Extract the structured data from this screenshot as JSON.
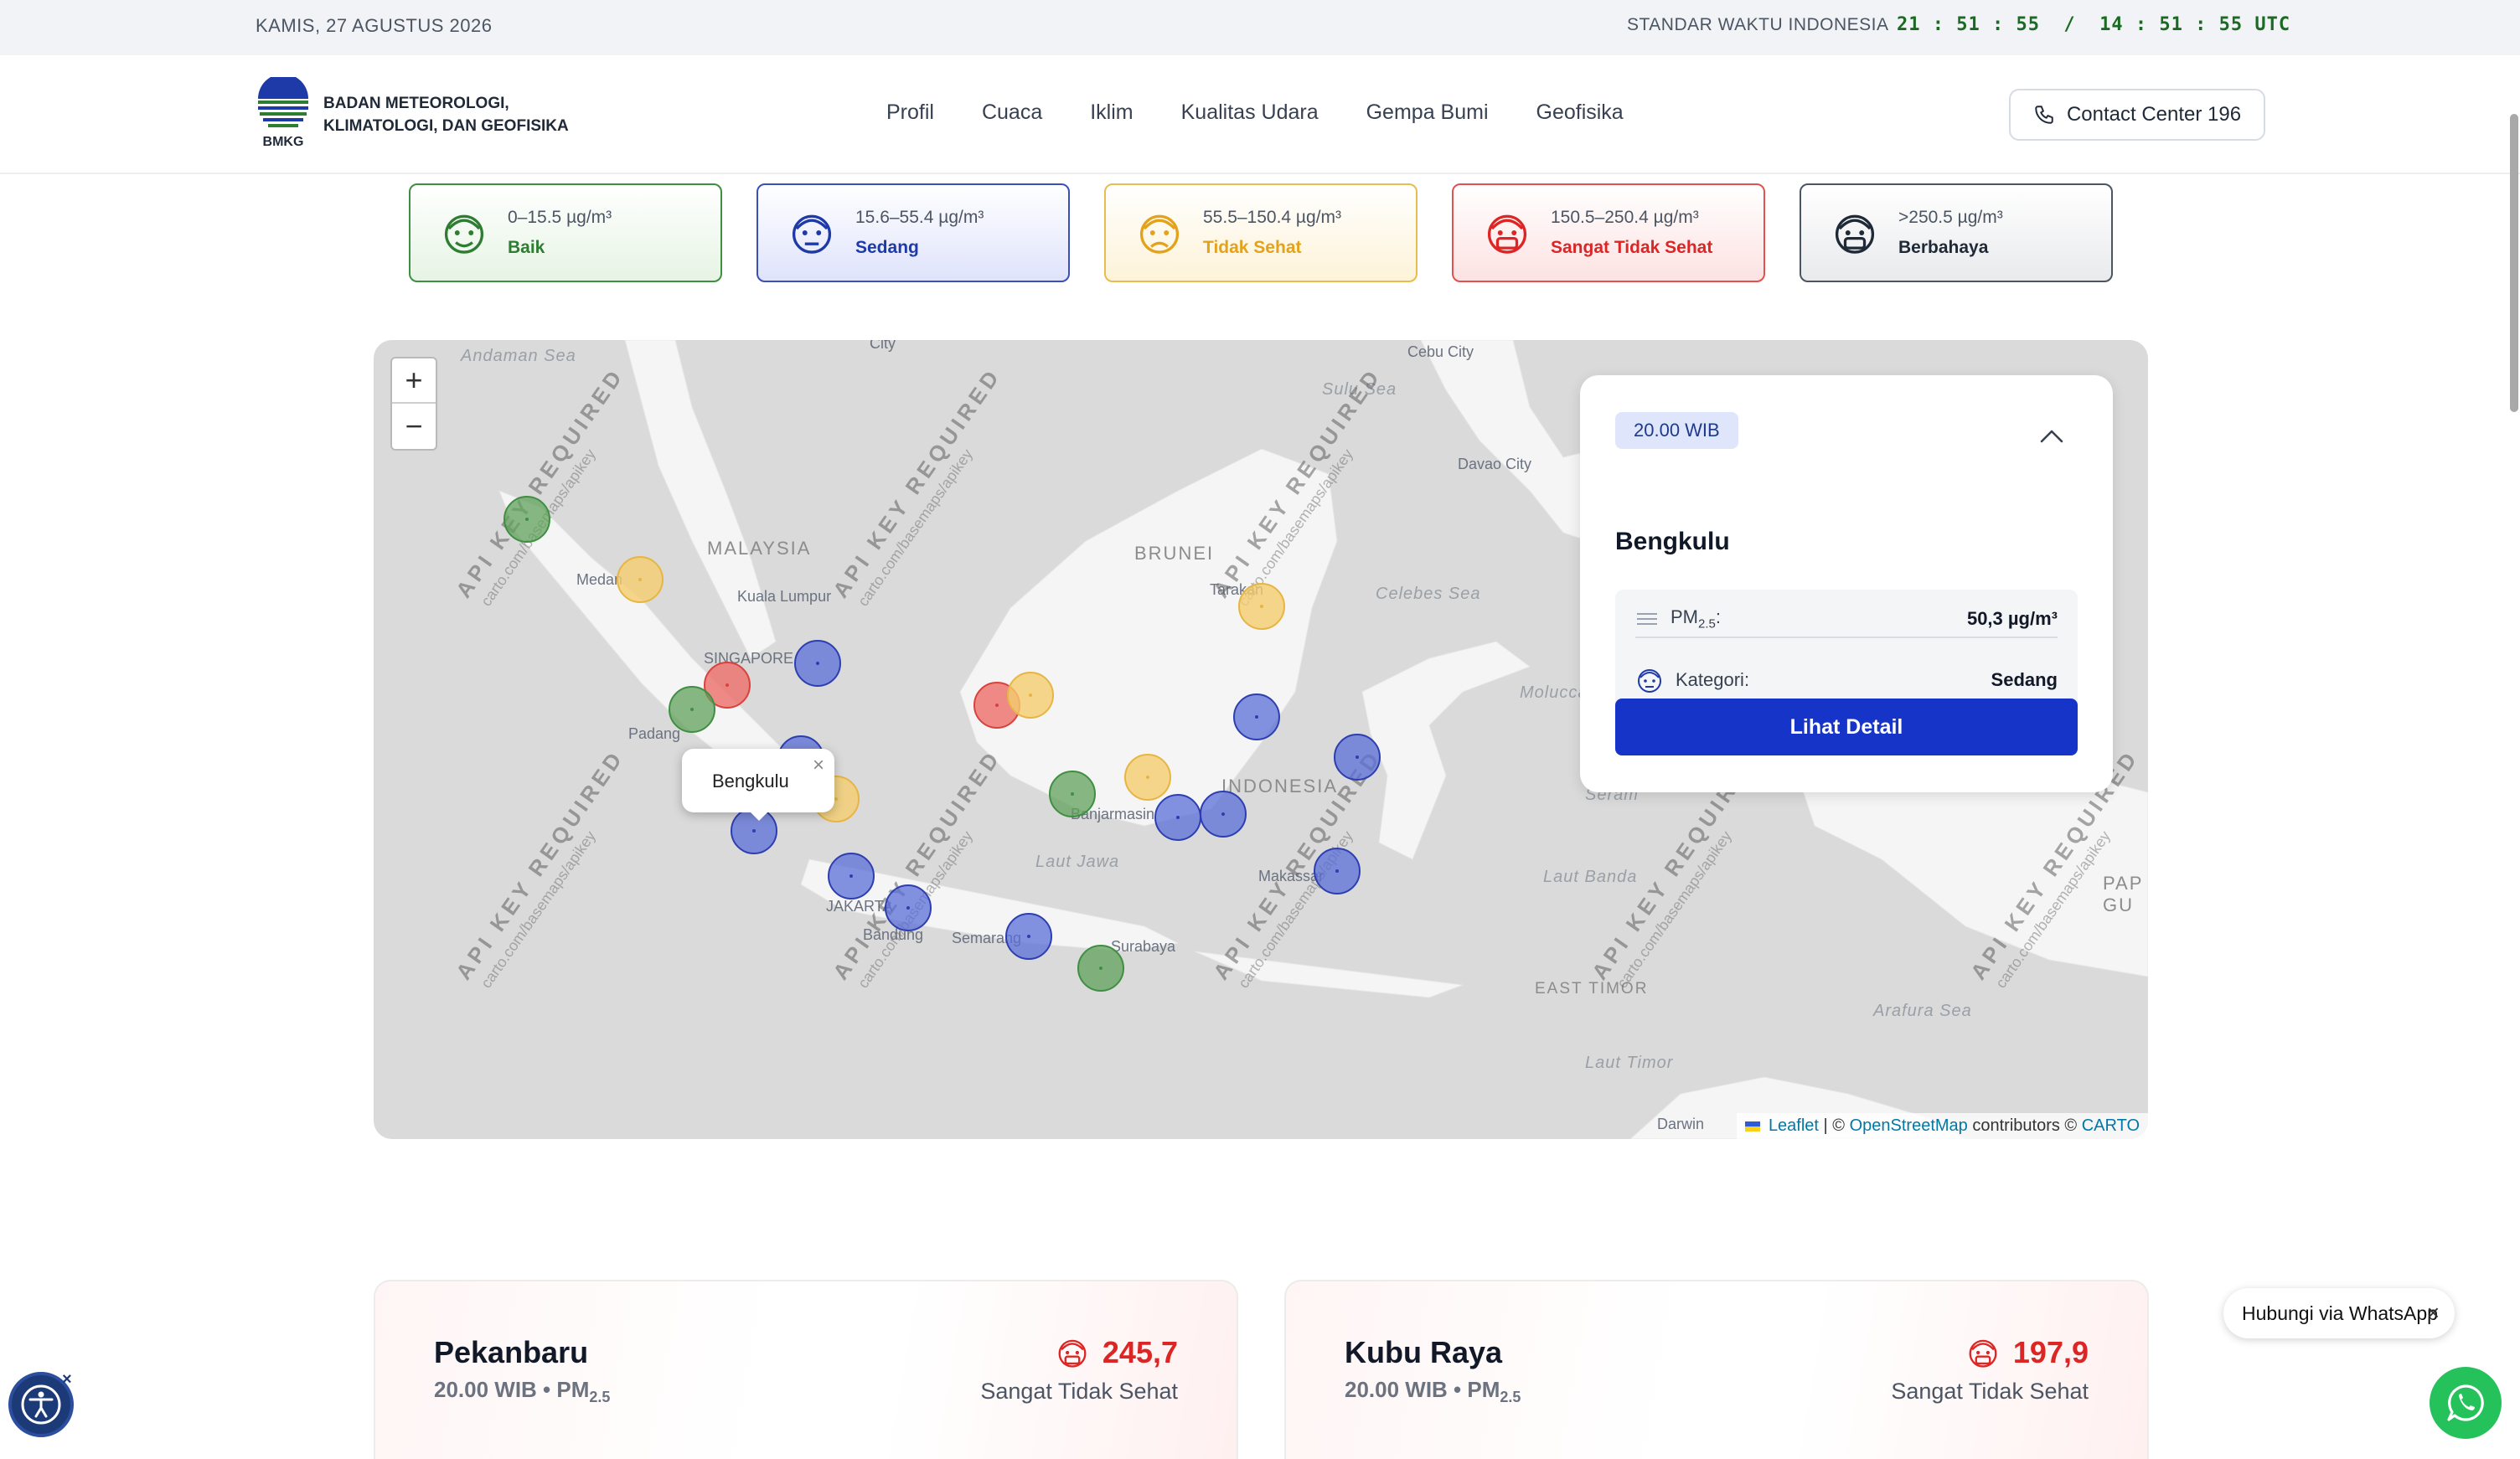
{
  "topbar": {
    "date": "KAMIS, 27 AGUSTUS 2026",
    "standard_label": "STANDAR WAKTU INDONESIA",
    "clock": "21 : 51 : 55  /  14 : 51 : 55 UTC"
  },
  "header": {
    "org_name_line1": "BADAN METEOROLOGI,",
    "org_name_line2": "KLIMATOLOGI, DAN GEOFISIKA",
    "logo_text": "BMKG",
    "nav": [
      "Profil",
      "Cuaca",
      "Iklim",
      "Kualitas Udara",
      "Gempa Bumi",
      "Geofisika"
    ],
    "contact_label": "Contact Center 196"
  },
  "legend": [
    {
      "range": "0–15.5 µg/m³",
      "category": "Baik",
      "color": "#2f7d32",
      "bg": "#e6f4e4",
      "border": "#3f8f43"
    },
    {
      "range": "15.6–55.4 µg/m³",
      "category": "Sedang",
      "color": "#1e3aa8",
      "bg": "#dfe3fb",
      "border": "#3b4fb8"
    },
    {
      "range": "55.5–150.4 µg/m³",
      "category": "Tidak Sehat",
      "color": "#e4a21b",
      "bg": "#fdf3d9",
      "border": "#e7bd4f"
    },
    {
      "range": "150.5–250.4 µg/m³",
      "category": "Sangat Tidak Sehat",
      "color": "#dc2626",
      "bg": "#fde2e2",
      "border": "#e0514f"
    },
    {
      "range": ">250.5 µg/m³",
      "category": "Berbahaya",
      "color": "#1f2937",
      "bg": "#e9eaec",
      "border": "#4b5563"
    }
  ],
  "map": {
    "seas": [
      "Andaman Sea",
      "Sulu Sea",
      "Celebes Sea",
      "Molucca Sea",
      "Laut Jawa",
      "Laut Banda",
      "Arafura Sea",
      "Laut Timor",
      "Seram"
    ],
    "countries": [
      "MALAYSIA",
      "BRUNEI",
      "INDONESIA",
      "EAST TIMOR",
      "PAP GU"
    ],
    "cities": [
      "City",
      "Cebu City",
      "Davao City",
      "Medan",
      "Kuala Lumpur",
      "SINGAPORE",
      "Padang",
      "Tarakan",
      "Banjarmasin",
      "Makassar",
      "JAKARTA",
      "Bandung",
      "Semarang",
      "Surabaya",
      "Darwin"
    ],
    "watermark": "API KEY REQUIRED",
    "watermark_url": "carto.com/basemaps/apikey",
    "zoom_in": "+",
    "zoom_out": "−",
    "attribution_leaflet": "Leaflet",
    "attribution_sep": " | © ",
    "attribution_osm": "OpenStreetMap",
    "attribution_contrib": " contributors © ",
    "attribution_carto": "CARTO",
    "popup_label": "Bengkulu",
    "popup_close": "×",
    "stations": [
      {
        "level": "Baik"
      },
      {
        "level": "Tidak Sehat"
      },
      {
        "level": "Sangat Tidak Sehat"
      },
      {
        "level": "Sedang"
      },
      {
        "level": "Baik"
      },
      {
        "level": "Sedang"
      },
      {
        "level": "Tidak Sehat"
      },
      {
        "level": "Sedang"
      },
      {
        "level": "Sedang"
      },
      {
        "level": "Sedang"
      },
      {
        "level": "Sangat Tidak Sehat"
      },
      {
        "level": "Tidak Sehat"
      },
      {
        "level": "Baik"
      },
      {
        "level": "Tidak Sehat"
      },
      {
        "level": "Sedang"
      },
      {
        "level": "Sedang"
      },
      {
        "level": "Sedang"
      },
      {
        "level": "Tidak Sehat"
      },
      {
        "level": "Sedang"
      },
      {
        "level": "Sedang"
      },
      {
        "level": "Sedang"
      },
      {
        "level": "Baik"
      }
    ]
  },
  "panel": {
    "time_badge": "20.00 WIB",
    "city": "Bengkulu",
    "pm_label": "PM",
    "pm_sub": "2.5",
    "pm_colon": ":",
    "pm_value": "50,3 µg/m³",
    "category_label": "Kategori:",
    "category_value": "Sedang",
    "detail_button": "Lihat Detail"
  },
  "city_cards": [
    {
      "name": "Pekanbaru",
      "meta": "20.00 WIB • PM",
      "meta_sub": "2.5",
      "value": "245,7",
      "category": "Sangat Tidak Sehat"
    },
    {
      "name": "Kubu Raya",
      "meta": "20.00 WIB • PM",
      "meta_sub": "2.5",
      "value": "197,9",
      "category": "Sangat Tidak Sehat"
    }
  ],
  "whatsapp": {
    "label": "Hubungi via WhatsApp",
    "close": "×"
  },
  "accessibility": {
    "close": "×"
  }
}
